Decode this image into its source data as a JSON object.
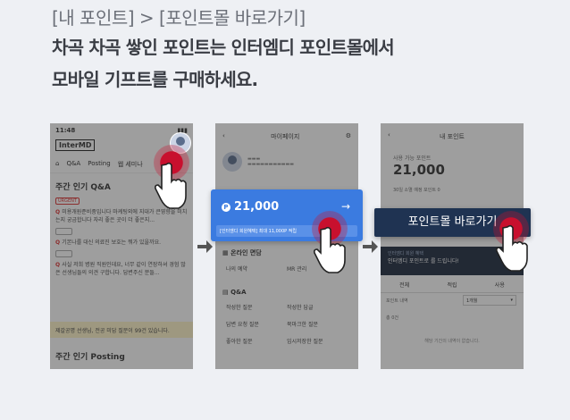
{
  "header": {
    "breadcrumb": "[내 포인트] > [포인트몰 바로가기]",
    "line1": "차곡 차곡 쌓인 포인트는 인터엠디 포인트몰에서",
    "line2": "모바일 기프트를 구매하세요."
  },
  "screen1": {
    "time": "11:48",
    "logo": "InterMD",
    "nav": [
      "Q&A",
      "Posting",
      "웹 세미나"
    ],
    "section1": "주간 인기 Q&A",
    "urgent_tag": "URGENT",
    "q1": "미용개원준비중입니다 마케팅외에 지대가 큰영향을 미치는지 궁금합니다 자리 좋은 곳이 더 좋은지...",
    "q2": "기본나를 대신 의료진 보호는 뭐가 있을까요.",
    "q3": "사실 저희 병원 직원인데요, 너무 같이 연장하셔 경험 많은 선생님들의 의견 구합니다. 답변주신 분들...",
    "banner": "제갈공명 선생님, 전공 미답 질문이 99건 있습니다.",
    "section2": "주간 인기 Posting"
  },
  "screen2": {
    "title": "마이페이지",
    "points": "21,000",
    "sub": "[인터엠디 회원혜택] 최대 11,000P 적립",
    "sec1": "온라인 면담",
    "sec1_items": [
      "나의 예약",
      "MR 관리"
    ],
    "sec2": "Q&A",
    "sec2_items": [
      "작성한 질문",
      "작성한 답글",
      "답변 요청 질문",
      "북마크한 질문",
      "좋아한 질문",
      "임시저장한 질문"
    ]
  },
  "screen3": {
    "title": "내 포인트",
    "points_label": "사용 가능 포인트",
    "points": "21,000",
    "expire": "30일 소멸 예정 포인트 0",
    "button": "포인트몰 바로가기",
    "promo_sub": "인터엠디 회원 혜택",
    "promo": "인터엠디 포인트로 를 드립니다!",
    "tabs": [
      "전체",
      "적립",
      "사용"
    ],
    "row1": "포인트 내역",
    "select": "1개월",
    "row2": "총 0건",
    "empty": "해당 기간의 내역이 없습니다."
  },
  "colors": {
    "accent": "#3b7be0",
    "tap": "#c8102e",
    "dark_button": "#1f3352"
  }
}
